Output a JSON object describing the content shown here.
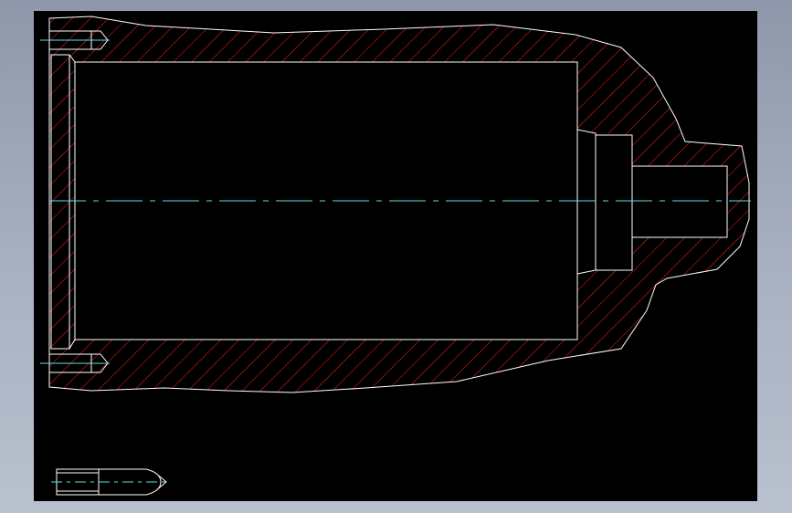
{
  "colors": {
    "background": "#000000",
    "outline": "#ffffff",
    "hatch": "#ff2020",
    "centerline": "#5fe0e0",
    "frame": "#9aa4b6"
  },
  "drawing": {
    "view": "sectioned-housing",
    "hatch_pattern": "diagonal-45"
  }
}
